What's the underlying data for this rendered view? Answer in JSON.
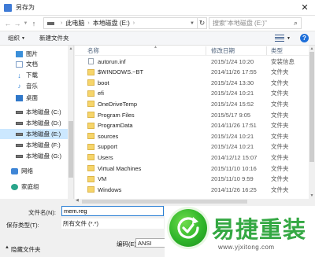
{
  "window": {
    "title": "另存为"
  },
  "address": {
    "segments": [
      "此电脑",
      "本地磁盘 (E:)"
    ],
    "search_placeholder": "搜索\"本地磁盘 (E:)\""
  },
  "toolbar": {
    "organize_label": "组织",
    "new_folder_label": "新建文件夹"
  },
  "nav": {
    "items": [
      {
        "label": "图片",
        "icon": "pictures-icon"
      },
      {
        "label": "文档",
        "icon": "documents-icon"
      },
      {
        "label": "下载",
        "icon": "downloads-icon"
      },
      {
        "label": "音乐",
        "icon": "music-icon"
      },
      {
        "label": "桌面",
        "icon": "desktop-icon"
      },
      {
        "label": "本地磁盘 (C:)",
        "icon": "drive-icon"
      },
      {
        "label": "本地磁盘 (D:)",
        "icon": "drive-icon"
      },
      {
        "label": "本地磁盘 (E:)",
        "icon": "drive-icon",
        "selected": true
      },
      {
        "label": "本地磁盘 (F:)",
        "icon": "drive-icon"
      },
      {
        "label": "本地磁盘 (G:)",
        "icon": "drive-icon"
      },
      {
        "label": "网络",
        "icon": "network-icon"
      },
      {
        "label": "家庭组",
        "icon": "homegroup-icon"
      }
    ]
  },
  "files": {
    "columns": {
      "name": "名称",
      "date": "修改日期",
      "type": "类型"
    },
    "rows": [
      {
        "name": "autorun.inf",
        "date": "2015/1/24 10:20",
        "type": "安装信息",
        "kind": "file"
      },
      {
        "name": "$WINDOWS.~BT",
        "date": "2014/11/26 17:55",
        "type": "文件夹",
        "kind": "folder"
      },
      {
        "name": "boot",
        "date": "2015/1/24 13:30",
        "type": "文件夹",
        "kind": "folder"
      },
      {
        "name": "efi",
        "date": "2015/1/24 10:21",
        "type": "文件夹",
        "kind": "folder"
      },
      {
        "name": "OneDriveTemp",
        "date": "2015/1/24 15:52",
        "type": "文件夹",
        "kind": "folder"
      },
      {
        "name": "Program Files",
        "date": "2015/5/17 9:05",
        "type": "文件夹",
        "kind": "folder"
      },
      {
        "name": "ProgramData",
        "date": "2014/11/26 17:51",
        "type": "文件夹",
        "kind": "folder"
      },
      {
        "name": "sources",
        "date": "2015/1/24 10:21",
        "type": "文件夹",
        "kind": "folder"
      },
      {
        "name": "support",
        "date": "2015/1/24 10:21",
        "type": "文件夹",
        "kind": "folder"
      },
      {
        "name": "Users",
        "date": "2014/12/12 15:07",
        "type": "文件夹",
        "kind": "folder"
      },
      {
        "name": "Virtual Machines",
        "date": "2015/11/10 10:16",
        "type": "文件夹",
        "kind": "folder"
      },
      {
        "name": "VM",
        "date": "2015/11/10 9:59",
        "type": "文件夹",
        "kind": "folder"
      },
      {
        "name": "Windows",
        "date": "2014/11/26 16:25",
        "type": "文件夹",
        "kind": "folder"
      }
    ]
  },
  "form": {
    "filename_label": "文件名(N):",
    "filename_value": "mem.reg",
    "filetype_label": "保存类型(T):",
    "filetype_value": "所有文件 (*.*)",
    "encoding_label": "编码(E):",
    "encoding_value": "ANSI",
    "hide_folders_label": "隐藏文件夹"
  },
  "brand": {
    "name": "易捷重装",
    "url": "www.yjxitong.com",
    "color": "#34a843"
  }
}
